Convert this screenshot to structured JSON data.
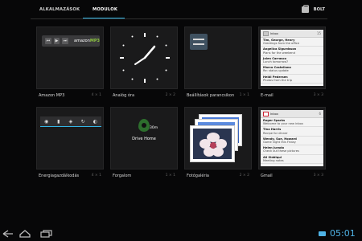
{
  "tabs": [
    {
      "label": "ALKALMAZÁSOK",
      "active": false
    },
    {
      "label": "MODULOK",
      "active": true
    }
  ],
  "store": {
    "label": "BOLT",
    "icon": "store-bag-icon"
  },
  "widgets": [
    {
      "name": "Amazon MP3",
      "size": "4 × 1"
    },
    {
      "name": "Analóg óra",
      "size": "2 × 2"
    },
    {
      "name": "Beállítások parancsikon",
      "size": "1 × 1"
    },
    {
      "name": "E-mail",
      "size": "3 × 3"
    },
    {
      "name": "Energiagazdálkodás",
      "size": "4 × 1"
    },
    {
      "name": "Forgalom",
      "size": "1 × 1"
    },
    {
      "name": "Fotógaléria",
      "size": "2 × 2"
    },
    {
      "name": "Gmail",
      "size": "3 × 3"
    }
  ],
  "mp3_widget": {
    "logo_text": "amazon",
    "logo_suffix": "MP3"
  },
  "drive_widget": {
    "time": "30m",
    "label": "Drive Home"
  },
  "email_preview": {
    "header": "Inbox",
    "count": "15",
    "rows": [
      {
        "from": "Tim, George, Henry",
        "subject": "Greetings from the office"
      },
      {
        "from": "Angelica Sigurdsson",
        "subject": "Plans for the weekend"
      },
      {
        "from": "Jalen Carrasco",
        "subject": "Lunch tomorrow?"
      },
      {
        "from": "Marco Castellano",
        "subject": "Re: status update"
      },
      {
        "from": "Heidi Pedersen",
        "subject": "Photos from the trip"
      }
    ]
  },
  "gmail_preview": {
    "header": "Inbox",
    "count": "6",
    "rows": [
      {
        "from": "Roger Sparks",
        "subject": "Welcome to your new inbox"
      },
      {
        "from": "Tina Harris",
        "subject": "Recipe for dinner"
      },
      {
        "from": "Wendy, Sue, Howard",
        "subject": "Game night this Friday"
      },
      {
        "from": "Helen Jurado",
        "subject": "Check out these pictures"
      },
      {
        "from": "Ali Siddiqui",
        "subject": "Meeting notes"
      }
    ]
  },
  "status": {
    "time": "05:01"
  },
  "nav": {
    "back": "back-icon",
    "home": "home-icon",
    "recents": "recents-icon"
  },
  "colors": {
    "accent": "#33b5e5",
    "card_bg": "#1a1a1b",
    "background": "#070708"
  }
}
